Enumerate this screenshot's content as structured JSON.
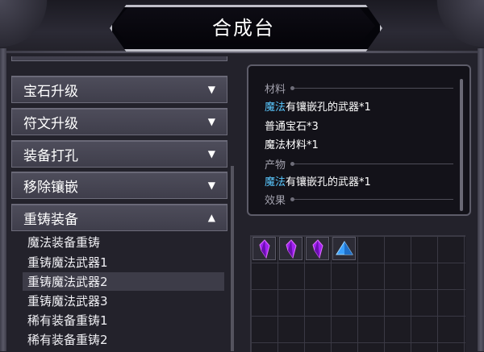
{
  "window": {
    "title": "合成台"
  },
  "categories": {
    "partial_top": "",
    "items": [
      {
        "label": "宝石升级",
        "arrow": "▼"
      },
      {
        "label": "符文升级",
        "arrow": "▼"
      },
      {
        "label": "装备打孔",
        "arrow": "▼"
      },
      {
        "label": "移除镶嵌",
        "arrow": "▼"
      },
      {
        "label": "重铸装备",
        "arrow": "▲"
      }
    ],
    "sub_items": [
      {
        "label": "魔法装备重铸",
        "selected": false
      },
      {
        "label": "重铸魔法武器1",
        "selected": false
      },
      {
        "label": "重铸魔法武器2",
        "selected": true
      },
      {
        "label": "重铸魔法武器3",
        "selected": false
      },
      {
        "label": "稀有装备重铸1",
        "selected": false
      },
      {
        "label": "稀有装备重铸2",
        "selected": false
      }
    ]
  },
  "recipe": {
    "materials_heading": "材料",
    "materials": [
      {
        "highlight": "魔法",
        "rest": "有镶嵌孔的武器*1"
      },
      {
        "highlight": "",
        "rest": "普通宝石*3"
      },
      {
        "highlight": "",
        "rest": "魔法材料*1"
      }
    ],
    "product_heading": "产物",
    "product": {
      "highlight": "魔法",
      "rest": "有镶嵌孔的武器*1"
    },
    "effect_heading": "效果",
    "effect_partial": ""
  },
  "slots": [
    {
      "icon": "purple-crystal-icon",
      "color": "#a020f0"
    },
    {
      "icon": "purple-crystal-icon",
      "color": "#a020f0"
    },
    {
      "icon": "purple-crystal-icon",
      "color": "#a020f0"
    },
    {
      "icon": "blue-pyramid-gem-icon",
      "color": "#3aa0ff"
    }
  ],
  "colors": {
    "highlight_text": "#5ac8ff",
    "panel_button": "#4a4957",
    "background": "#23222b"
  }
}
